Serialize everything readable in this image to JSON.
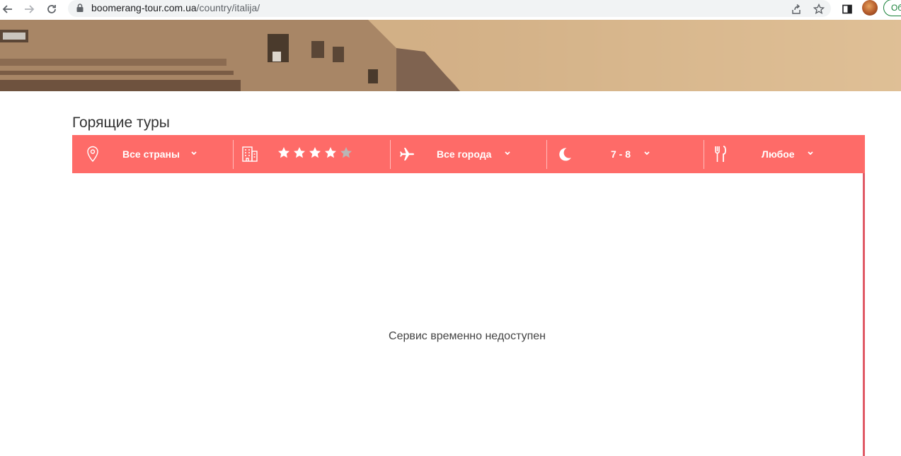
{
  "browser": {
    "url_domain": "boomerang-tour.com.ua",
    "url_path": "/country/italija/",
    "update_label": "Об"
  },
  "colors": {
    "accent": "#fe6b68",
    "border": "#e05a66"
  },
  "section": {
    "title": "Горящие туры"
  },
  "filters": {
    "country": {
      "icon": "map-pin-icon",
      "label": "Все страны"
    },
    "hotel": {
      "icon": "building-icon",
      "rating": 4,
      "max_rating": 5
    },
    "departure": {
      "icon": "airplane-icon",
      "label": "Все города"
    },
    "nights": {
      "icon": "moon-icon",
      "label": "7 - 8"
    },
    "meal": {
      "icon": "fork-knife-icon",
      "label": "Любое"
    }
  },
  "results": {
    "message": "Сервис временно недоступен"
  }
}
